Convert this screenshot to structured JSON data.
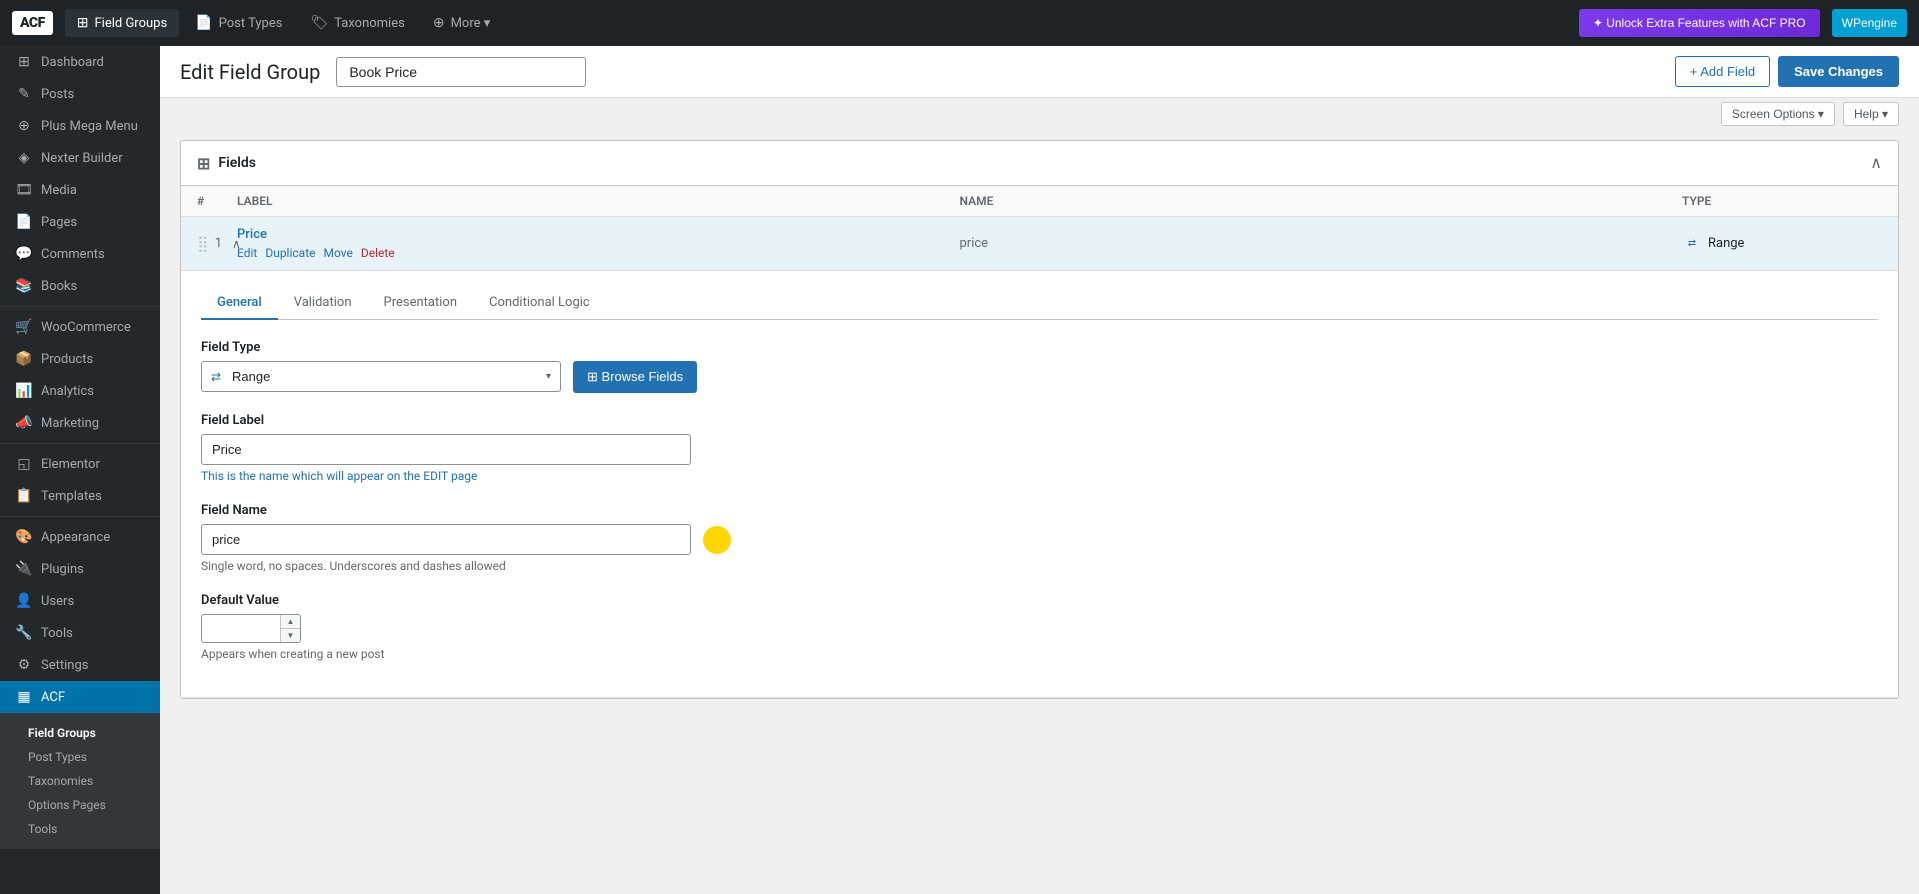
{
  "topNav": {
    "logo": "ACF",
    "tabs": [
      {
        "id": "field-groups",
        "label": "Field Groups",
        "icon": "⊞",
        "active": true
      },
      {
        "id": "post-types",
        "label": "Post Types",
        "icon": "📄",
        "active": false
      },
      {
        "id": "taxonomies",
        "label": "Taxonomies",
        "icon": "🏷",
        "active": false
      },
      {
        "id": "more",
        "label": "More ▾",
        "icon": "⊕",
        "active": false
      }
    ],
    "unlockBtn": "✦ Unlock Extra Features with ACF PRO",
    "wpEngineBtn": "WPengine"
  },
  "sidebar": {
    "items": [
      {
        "id": "dashboard",
        "label": "Dashboard",
        "icon": "⊞"
      },
      {
        "id": "posts",
        "label": "Posts",
        "icon": "✎"
      },
      {
        "id": "plus-mega-menu",
        "label": "Plus Mega Menu",
        "icon": "⊕"
      },
      {
        "id": "nexter-builder",
        "label": "Nexter Builder",
        "icon": "◈"
      },
      {
        "id": "media",
        "label": "Media",
        "icon": "🎞"
      },
      {
        "id": "pages",
        "label": "Pages",
        "icon": "📄"
      },
      {
        "id": "comments",
        "label": "Comments",
        "icon": "💬"
      },
      {
        "id": "books",
        "label": "Books",
        "icon": "📚"
      },
      {
        "id": "woocommerce",
        "label": "WooCommerce",
        "icon": "🛒"
      },
      {
        "id": "products",
        "label": "Products",
        "icon": "📦"
      },
      {
        "id": "analytics",
        "label": "Analytics",
        "icon": "📊"
      },
      {
        "id": "marketing",
        "label": "Marketing",
        "icon": "📣"
      },
      {
        "id": "elementor",
        "label": "Elementor",
        "icon": "◱"
      },
      {
        "id": "templates",
        "label": "Templates",
        "icon": "📋"
      },
      {
        "id": "appearance",
        "label": "Appearance",
        "icon": "🎨"
      },
      {
        "id": "plugins",
        "label": "Plugins",
        "icon": "🔌"
      },
      {
        "id": "users",
        "label": "Users",
        "icon": "👤"
      },
      {
        "id": "tools",
        "label": "Tools",
        "icon": "🔧"
      },
      {
        "id": "settings",
        "label": "Settings",
        "icon": "⚙"
      },
      {
        "id": "acf",
        "label": "ACF",
        "icon": "▦",
        "active": true
      }
    ],
    "subItems": [
      {
        "id": "field-groups",
        "label": "Field Groups",
        "active": true
      },
      {
        "id": "post-types",
        "label": "Post Types"
      },
      {
        "id": "taxonomies",
        "label": "Taxonomies"
      },
      {
        "id": "options-pages",
        "label": "Options Pages"
      },
      {
        "id": "tools",
        "label": "Tools"
      }
    ]
  },
  "pageHeader": {
    "title": "Edit Field Group",
    "fieldGroupName": "Book Price",
    "addFieldBtn": "+ Add Field",
    "saveChangesBtn": "Save Changes"
  },
  "screenOptions": {
    "screenOptionsBtn": "Screen Options ▾",
    "helpBtn": "Help ▾"
  },
  "fieldsBox": {
    "title": "Fields",
    "fields": [
      {
        "num": 1,
        "label": "Price",
        "name": "price",
        "type": "Range",
        "actions": [
          "Edit",
          "Duplicate",
          "Move",
          "Delete"
        ]
      }
    ]
  },
  "fieldEdit": {
    "tabs": [
      "General",
      "Validation",
      "Presentation",
      "Conditional Logic"
    ],
    "activeTab": "General",
    "fieldType": {
      "label": "Field Type",
      "value": "Range",
      "icon": "⇄",
      "browseFieldsBtn": "⊞ Browse Fields"
    },
    "fieldLabel": {
      "label": "Field Label",
      "value": "Price",
      "hint": "This is the name which will appear on the EDIT page"
    },
    "fieldName": {
      "label": "Field Name",
      "value": "price",
      "hint": "Single word, no spaces. Underscores and dashes allowed"
    },
    "defaultValue": {
      "label": "Default Value",
      "value": "",
      "hint": "Appears when creating a new post"
    }
  }
}
